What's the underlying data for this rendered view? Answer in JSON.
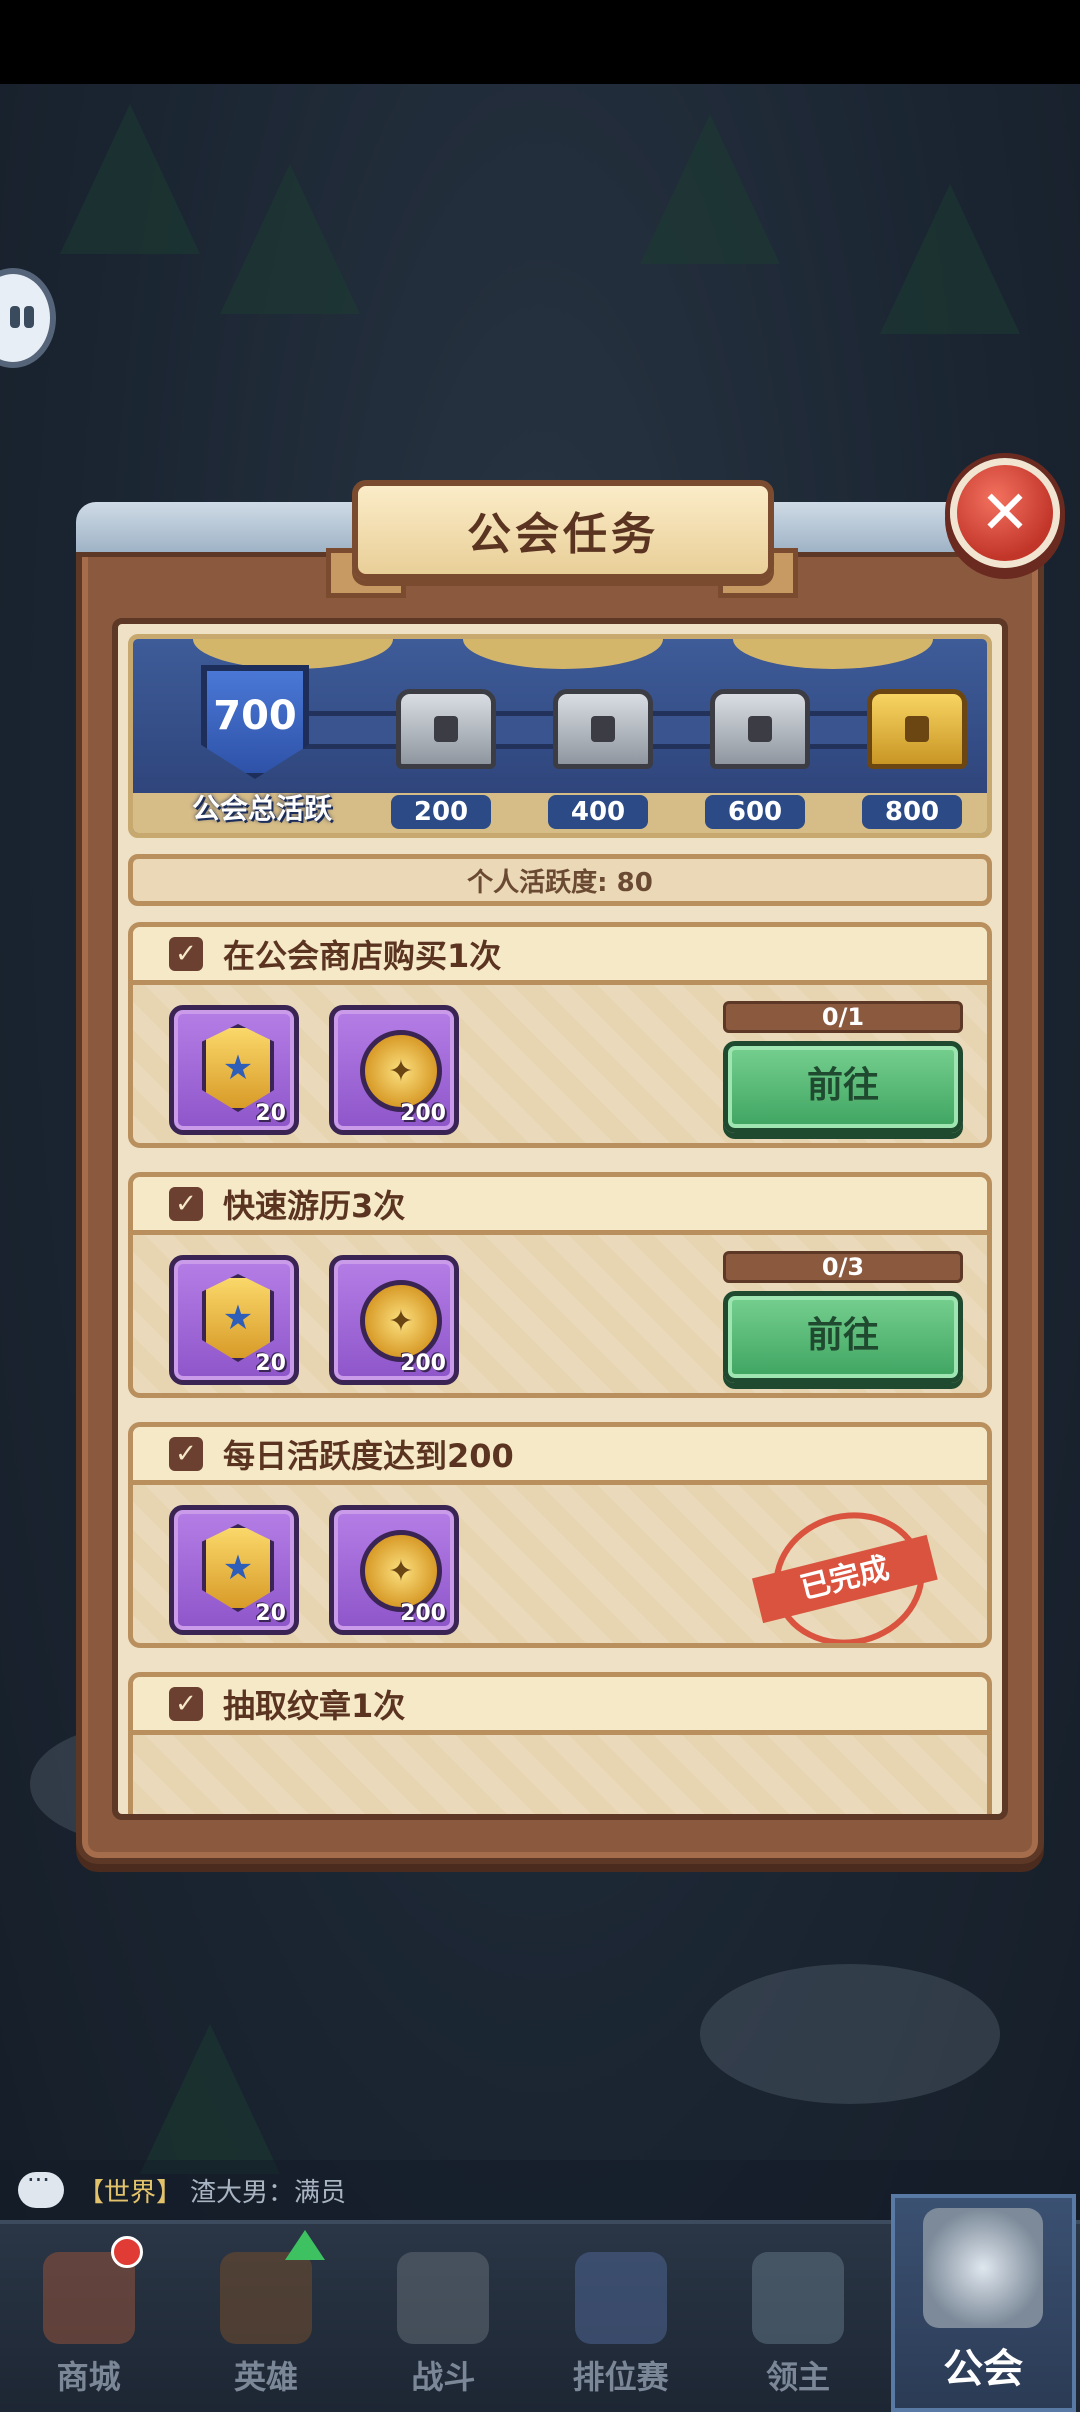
{
  "panel": {
    "title": "公会任务",
    "close_label": "✕"
  },
  "guild_activity": {
    "total_value": "700",
    "total_label": "公会总活跃",
    "milestones": [
      {
        "value": "200",
        "chest": "silver-chest-icon"
      },
      {
        "value": "400",
        "chest": "silver-chest-icon"
      },
      {
        "value": "600",
        "chest": "silver-chest-icon"
      },
      {
        "value": "800",
        "chest": "gold-chest-icon"
      }
    ]
  },
  "personal_activity": "个人活跃度: 80",
  "tasks": [
    {
      "title": "在公会商店购买1次",
      "rewards": [
        {
          "icon": "badge-icon",
          "qty": "20"
        },
        {
          "icon": "coin-icon",
          "qty": "200"
        }
      ],
      "progress": "0/1",
      "action": "前往"
    },
    {
      "title": "快速游历3次",
      "rewards": [
        {
          "icon": "badge-icon",
          "qty": "20"
        },
        {
          "icon": "coin-icon",
          "qty": "200"
        }
      ],
      "progress": "0/3",
      "action": "前往"
    },
    {
      "title": "每日活跃度达到200",
      "rewards": [
        {
          "icon": "badge-icon",
          "qty": "20"
        },
        {
          "icon": "coin-icon",
          "qty": "200"
        }
      ],
      "status": "已完成"
    },
    {
      "title": "抽取纹章1次"
    }
  ],
  "chat": {
    "channel": "【世界】",
    "message": "渣大男：满员"
  },
  "nav": [
    {
      "label": "商城",
      "icon": "shop-icon"
    },
    {
      "label": "英雄",
      "icon": "hero-icon"
    },
    {
      "label": "战斗",
      "icon": "battle-icon"
    },
    {
      "label": "排位赛",
      "icon": "ranking-icon"
    },
    {
      "label": "领主",
      "icon": "lord-icon"
    },
    {
      "label": "公会",
      "icon": "guild-icon",
      "active": true
    }
  ],
  "colors": {
    "panel_wood": "#8b5a3e",
    "go_button": "#3fa461",
    "stamp_red": "#d9533f",
    "reward_purple": "#8d55c9",
    "track_blue": "#2b4a86"
  }
}
